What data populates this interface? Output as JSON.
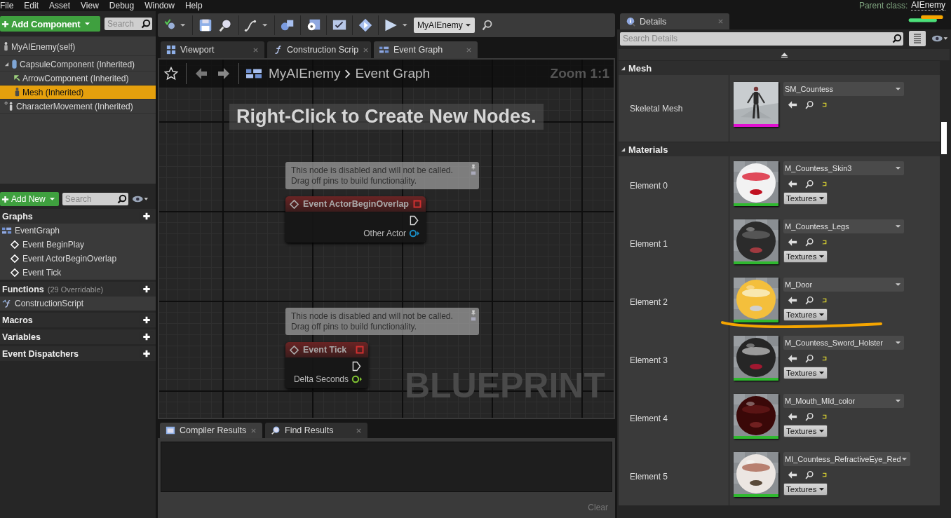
{
  "menu": [
    "File",
    "Edit",
    "Asset",
    "View",
    "Debug",
    "Window",
    "Help"
  ],
  "parent_class": {
    "label": "Parent class:",
    "value": "AIEnemy"
  },
  "components": {
    "add_button": "Add Component",
    "search": {
      "placeholder": "Search"
    },
    "tree": [
      {
        "label": "MyAIEnemy(self)",
        "kind": "actor",
        "selected": false,
        "children": [
          {
            "label": "CapsuleComponent (Inherited)",
            "kind": "capsule",
            "selected": false,
            "expanded": true,
            "children": [
              {
                "label": "ArrowComponent (Inherited)",
                "kind": "arrow",
                "selected": false
              },
              {
                "label": "Mesh (Inherited)",
                "kind": "mesh",
                "selected": true
              }
            ]
          },
          {
            "label": "CharacterMovement (Inherited)",
            "kind": "movement",
            "selected": false
          }
        ]
      }
    ]
  },
  "my_blueprint": {
    "add_button": "Add New",
    "search": {
      "placeholder": "Search"
    },
    "sections": [
      {
        "title": "Graphs",
        "items": [
          {
            "label": "EventGraph",
            "kind": "graph",
            "children": [
              {
                "label": "Event BeginPlay",
                "kind": "event"
              },
              {
                "label": "Event ActorBeginOverlap",
                "kind": "event"
              },
              {
                "label": "Event Tick",
                "kind": "event"
              }
            ]
          }
        ]
      },
      {
        "title": "Functions",
        "note": "(29 Overridable)",
        "items": [
          {
            "label": "ConstructionScript",
            "kind": "function"
          }
        ]
      },
      {
        "title": "Macros"
      },
      {
        "title": "Variables"
      },
      {
        "title": "Event Dispatchers"
      }
    ]
  },
  "toolbar": {
    "debug_filter": "MyAIEnemy"
  },
  "tabs": [
    {
      "label": "Viewport",
      "kind": "viewport",
      "selected": false
    },
    {
      "label": "Construction Scrip",
      "kind": "function",
      "selected": false
    },
    {
      "label": "Event Graph",
      "kind": "graph",
      "selected": true
    }
  ],
  "graph": {
    "breadcrumb": [
      "MyAIEnemy",
      "Event Graph"
    ],
    "zoom": "Zoom 1:1",
    "hint": "Right-Click to Create New Nodes.",
    "watermark": "BLUEPRINT",
    "nodes": [
      {
        "comment": "This node is disabled and will not be called.\nDrag off pins to build functionality.",
        "title": "Event ActorBeginOverlap",
        "pin": {
          "label": "Other Actor",
          "color": "#1a8fc8"
        }
      },
      {
        "comment": "This node is disabled and will not be called.\nDrag off pins to build functionality.",
        "title": "Event Tick",
        "pin": {
          "label": "Delta Seconds",
          "color": "#7fc232"
        }
      }
    ]
  },
  "bottom_tabs": [
    {
      "label": "Compiler Results",
      "kind": "compiler",
      "selected": true
    },
    {
      "label": "Find Results",
      "kind": "find",
      "selected": false
    }
  ],
  "clear_button": "Clear",
  "details": {
    "tab": "Details",
    "search": {
      "placeholder": "Search Details"
    },
    "sections": [
      {
        "title": "Mesh",
        "rows": [
          {
            "label": "Skeletal Mesh",
            "kind": "mesh",
            "asset": "SM_Countess",
            "color": "#e010d0"
          }
        ]
      },
      {
        "title": "Materials",
        "rows": [
          {
            "label": "Element 0",
            "kind": "material",
            "asset": "M_Countess_Skin3",
            "color": "#2fb82f",
            "button": "Textures"
          },
          {
            "label": "Element 1",
            "kind": "material",
            "asset": "M_Countess_Legs",
            "color": "#2fb82f",
            "button": "Textures"
          },
          {
            "label": "Element 2",
            "kind": "material",
            "asset": "M_Door",
            "color": "#2fb82f",
            "button": "Textures"
          },
          {
            "label": "Element 3",
            "kind": "material",
            "asset": "M_Countess_Sword_Holster",
            "color": "#2fb82f",
            "button": "Textures"
          },
          {
            "label": "Element 4",
            "kind": "material",
            "asset": "M_Mouth_MId_color",
            "color": "#2fb82f",
            "button": "Textures"
          },
          {
            "label": "Element 5",
            "kind": "material",
            "asset": "MI_Countess_RefractiveEye_Red",
            "color": "#2fb82f",
            "button": "Textures"
          }
        ]
      }
    ]
  }
}
